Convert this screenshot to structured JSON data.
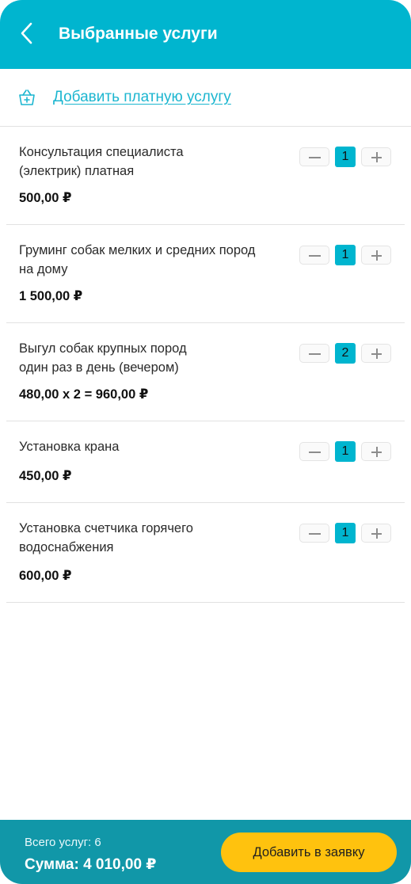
{
  "header": {
    "title": "Выбранные услуги",
    "back_icon": "chevron-left-icon"
  },
  "add_service": {
    "icon": "basket-add-icon",
    "label": "Добавить платную услугу"
  },
  "services": [
    {
      "name_lines": [
        "Консультация специалиста",
        "(электрик) платная"
      ],
      "price": "500,00 ₽",
      "quantity": "1"
    },
    {
      "name_lines": [
        "Груминг собак мелких и средних пород",
        "на дому"
      ],
      "price": "1 500,00 ₽",
      "quantity": "1"
    },
    {
      "name_lines": [
        "Выгул собак крупных пород",
        "один раз в день (вечером)"
      ],
      "price": "480,00 х 2 = 960,00 ₽",
      "quantity": "2"
    },
    {
      "name_lines": [
        "Установка крана"
      ],
      "price": "450,00 ₽",
      "quantity": "1"
    },
    {
      "name_lines": [
        "Установка счетчика горячего",
        "водоснабжения"
      ],
      "price": "600,00 ₽",
      "quantity": "1"
    }
  ],
  "footer": {
    "total_count": "Всего услуг: 6",
    "total_sum": "Сумма: 4 010,00 ₽",
    "submit_label": "Добавить в заявку"
  },
  "colors": {
    "header": "#00b5cf",
    "link": "#1cb6d0",
    "footer": "#1197a8",
    "button": "#ffc20e"
  }
}
